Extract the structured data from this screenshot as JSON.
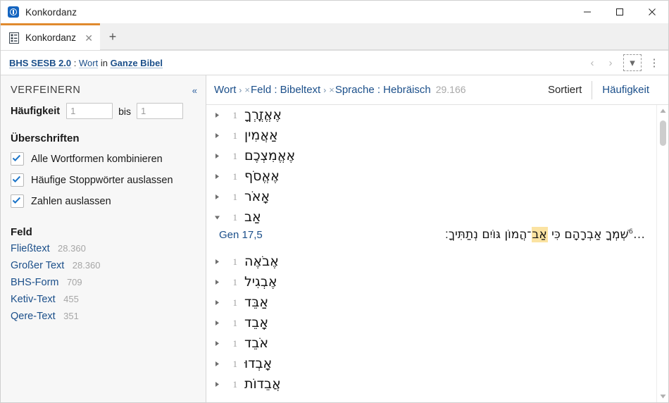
{
  "window": {
    "title": "Konkordanz",
    "app_icon": "konkordanz-app-icon",
    "minimize": "—",
    "maximize": "□",
    "close": "✕"
  },
  "tabs": {
    "items": [
      {
        "label": "Konkordanz",
        "icon": "concordance-grid-icon",
        "close": "✕",
        "active": true
      }
    ],
    "new_tab": "+"
  },
  "toolbar": {
    "path_prefix": "BHS SESB 2.0",
    "path_sep1": " : ",
    "path_mid": "Wort",
    "path_in": " in ",
    "path_suffix": "Ganze Bibel",
    "back": "‹",
    "forward": "›",
    "dropdown": "▾",
    "menu": "⋮"
  },
  "sidebar": {
    "title": "VERFEINERN",
    "collapse": "«",
    "frequency": {
      "label": "Häufigkeit",
      "from_value": "1",
      "between_label": "bis",
      "to_value": "1"
    },
    "headings_section": "Überschriften",
    "checkboxes": [
      {
        "label": "Alle Wortformen kombinieren",
        "checked": true
      },
      {
        "label": "Häufige Stoppwörter auslassen",
        "checked": true
      },
      {
        "label": "Zahlen auslassen",
        "checked": true
      }
    ],
    "field_section": "Feld",
    "fields": [
      {
        "name": "Fließtext",
        "count": "28.360"
      },
      {
        "name": "Großer Text",
        "count": "28.360"
      },
      {
        "name": "BHS-Form",
        "count": "709"
      },
      {
        "name": "Ketiv-Text",
        "count": "455"
      },
      {
        "name": "Qere-Text",
        "count": "351"
      }
    ]
  },
  "main": {
    "breadcrumb": {
      "root": "Wort",
      "chev": "›",
      "xmark": "×",
      "item1": "Feld : Bibeltext",
      "item2": "Sprache : Hebräisch",
      "total": "29.166"
    },
    "view_tabs": [
      {
        "label": "Sortiert",
        "active": true
      },
      {
        "label": "Häufigkeit",
        "active": false
      }
    ],
    "results": [
      {
        "count": "1",
        "word": "אֶאֱזֳרְךָ",
        "expanded": false
      },
      {
        "count": "1",
        "word": "אַאֲמִין",
        "expanded": false
      },
      {
        "count": "1",
        "word": "אֶאֱמִצְכֶם",
        "expanded": false
      },
      {
        "count": "1",
        "word": "אֶאֱסֹף",
        "expanded": false
      },
      {
        "count": "1",
        "word": "אָאֹר",
        "expanded": false
      },
      {
        "count": "1",
        "word": "אַב",
        "expanded": true
      }
    ],
    "verse": {
      "reference": "Gen 17,5",
      "text_before": "שְׁמְךָ אַבְרָהָם כִּי ",
      "highlight": "אַב",
      "text_after": "־הֲמוֹן גּוֹיִם נְתַתִּיךָ׃",
      "verse_number": "6",
      "ellipsis": "…"
    },
    "results_after": [
      {
        "count": "1",
        "word": "אֶבֹאֶה",
        "expanded": false
      },
      {
        "count": "1",
        "word": "אֶבְגִיל",
        "expanded": false
      },
      {
        "count": "1",
        "word": "אַבֵּד",
        "expanded": false
      },
      {
        "count": "1",
        "word": "אָבֵד",
        "expanded": false
      },
      {
        "count": "1",
        "word": "אֹבֵד",
        "expanded": false
      },
      {
        "count": "1",
        "word": "אָבְדוּ",
        "expanded": false
      },
      {
        "count": "1",
        "word": "אֲבֵדוֹת",
        "expanded": false
      }
    ]
  },
  "scrollbar": {
    "up": "▴",
    "down": "▾"
  },
  "colors": {
    "link": "#1b4f8a",
    "tab_accent": "#e08a2e",
    "highlight": "#fbe3a2",
    "sidebar_bg": "#f7f7f7",
    "muted": "#a6a6a6"
  }
}
